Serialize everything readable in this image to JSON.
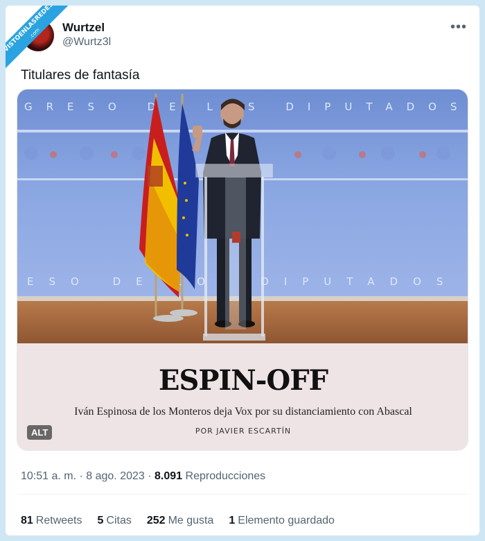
{
  "watermark": {
    "line1": "VISTOENLASREDES",
    "line2": ".com"
  },
  "author": {
    "name": "Wurtzel",
    "handle": "@Wurtz3l"
  },
  "more_icon": "more-horizontal-icon",
  "tweet": {
    "text": "Titulares de fantasía"
  },
  "media": {
    "backdrop_text_top": "GRESO DE LOS DIPUTADOS",
    "backdrop_text_bottom": "ESO DE LOS DIPUTADOS",
    "headline": "ESPIN-OFF",
    "subheadline": "Iván Espinosa de los Monteros deja Vox por su distanciamiento con Abascal",
    "byline": "POR   JAVIER ESCARTÍN",
    "alt_label": "ALT"
  },
  "meta": {
    "time": "10:51 a. m.",
    "date": "8 ago. 2023",
    "views": "8.091",
    "views_label": "Reproducciones"
  },
  "stats": {
    "retweets": "81",
    "retweets_label": "Retweets",
    "quotes": "5",
    "quotes_label": "Citas",
    "likes": "252",
    "likes_label": "Me gusta",
    "bookmarks": "1",
    "bookmarks_label": "Elemento guardado"
  },
  "colors": {
    "background": "#cfe6f5",
    "accent": "#2aa3e0",
    "caption_bg": "#eee4e6"
  }
}
